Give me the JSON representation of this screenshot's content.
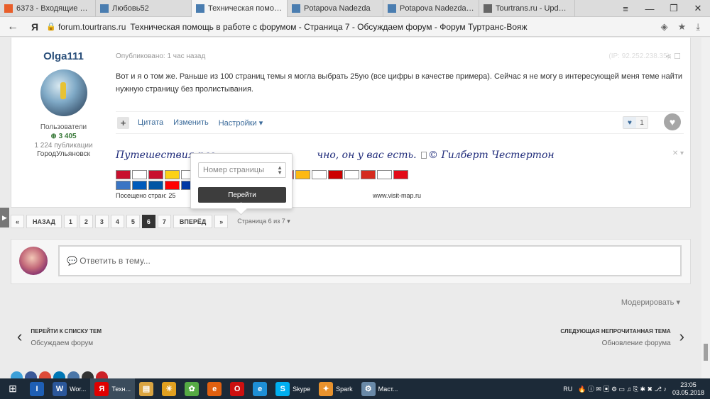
{
  "browser": {
    "tabs": [
      {
        "label": "6373 - Входящие — Янде",
        "icon_color": "#e85e2a",
        "active": false
      },
      {
        "label": "Любовь52",
        "icon_color": "#4a7db0",
        "active": false
      },
      {
        "label": "Техническая помощь в",
        "icon_color": "#4a7db0",
        "active": true
      },
      {
        "label": "Potapova Nadezda",
        "icon_color": "#4a7db0",
        "active": false
      },
      {
        "label": "Potapova Nadezda - Фор",
        "icon_color": "#4a7db0",
        "active": false
      },
      {
        "label": "Tourtrans.ru - Update Tou",
        "icon_color": "#666666",
        "active": false
      }
    ],
    "address": {
      "domain": "forum.tourtrans.ru",
      "page_title": "Техническая помощь в работе с форумом - Страница 7 - Обсуждаем форум - Форум Туртранс-Вояж"
    }
  },
  "post": {
    "author": {
      "name": "Olga111",
      "role": "Пользователи",
      "reputation": "3 405",
      "posts": "1 224 публикации",
      "city": "ГородУльяновск"
    },
    "meta": "Опубликовано: 1 час назад",
    "ip": "(IP: 92.252.238.35)",
    "text": "Вот и я о том же. Раньше из 100 страниц темы я могла выбрать 25ую (все цифры в качестве примера). Сейчас я не могу в интересующей меня теме найти нужную страницу без пролистывания.",
    "actions": {
      "quote": "Цитата",
      "edit": "Изменить",
      "settings": "Настройки"
    },
    "likes": "1",
    "signature": {
      "text_before": "Путешествия раз",
      "text_after": "чно, он у вас есть.",
      "quote_author": "© Гилберт Честертон",
      "visits": "Посещено стран: 25",
      "visitmap": "www.visit-map.ru"
    }
  },
  "flags_row1": [
    "#c8102e",
    "#ffffff",
    "#c8102e",
    "#fcd116",
    "#ffffff",
    "#000000",
    "#0055a4",
    "#ff0000",
    "#ffcc00",
    "#ffffff",
    "#ce1126",
    "#fdb913",
    "#ffffff",
    "#cc0000",
    "#ffffff",
    "#d52b1e",
    "#ffffff",
    "#e30a17"
  ],
  "flags_row2": [
    "#3a75c4",
    "#005bbb",
    "#0055a4",
    "#ff0000",
    "#0039a6"
  ],
  "page_jump": {
    "placeholder": "Номер страницы",
    "go_label": "Перейти"
  },
  "pagination": {
    "first": "«",
    "prev": "НАЗАД",
    "pages": [
      "1",
      "2",
      "3",
      "4",
      "5",
      "6",
      "7"
    ],
    "current": "6",
    "next": "ВПЕРЁД",
    "last": "»",
    "info": "Страница 6 из 7"
  },
  "reply": {
    "placeholder": "Ответить в тему..."
  },
  "moderate": "Модерировать",
  "nav": {
    "prev_label": "ПЕРЕЙТИ К СПИСКУ ТЕМ",
    "prev_sub": "Обсуждаем форум",
    "next_label": "СЛЕДУЮЩАЯ НЕПРОЧИТАННАЯ ТЕМА",
    "next_sub": "Обновление форума"
  },
  "social_colors": [
    "#3ca0d9",
    "#3b5998",
    "#dd4b39",
    "#0077b5",
    "#4a76a8",
    "#333333",
    "#cc2127"
  ],
  "taskbar": {
    "items": [
      {
        "label": "",
        "icon": "I",
        "color": "#1e5fb5"
      },
      {
        "label": "Wor...",
        "icon": "W",
        "color": "#2b579a"
      },
      {
        "label": "Техн...",
        "icon": "Я",
        "color": "#e00000"
      },
      {
        "label": "",
        "icon": "▤",
        "color": "#d9a441"
      },
      {
        "label": "",
        "icon": "☀",
        "color": "#e0a020"
      },
      {
        "label": "",
        "icon": "✿",
        "color": "#55aa44"
      },
      {
        "label": "",
        "icon": "e",
        "color": "#e06010"
      },
      {
        "label": "",
        "icon": "O",
        "color": "#cc1010"
      },
      {
        "label": "",
        "icon": "e",
        "color": "#1e8fd6"
      },
      {
        "label": "Skype",
        "icon": "S",
        "color": "#00aff0"
      },
      {
        "label": "Spark",
        "icon": "✦",
        "color": "#e8922d"
      },
      {
        "label": "Маст...",
        "icon": "⚙",
        "color": "#6a8aa8"
      }
    ],
    "lang": "RU",
    "time": "23:05",
    "date": "03.05.2018"
  }
}
